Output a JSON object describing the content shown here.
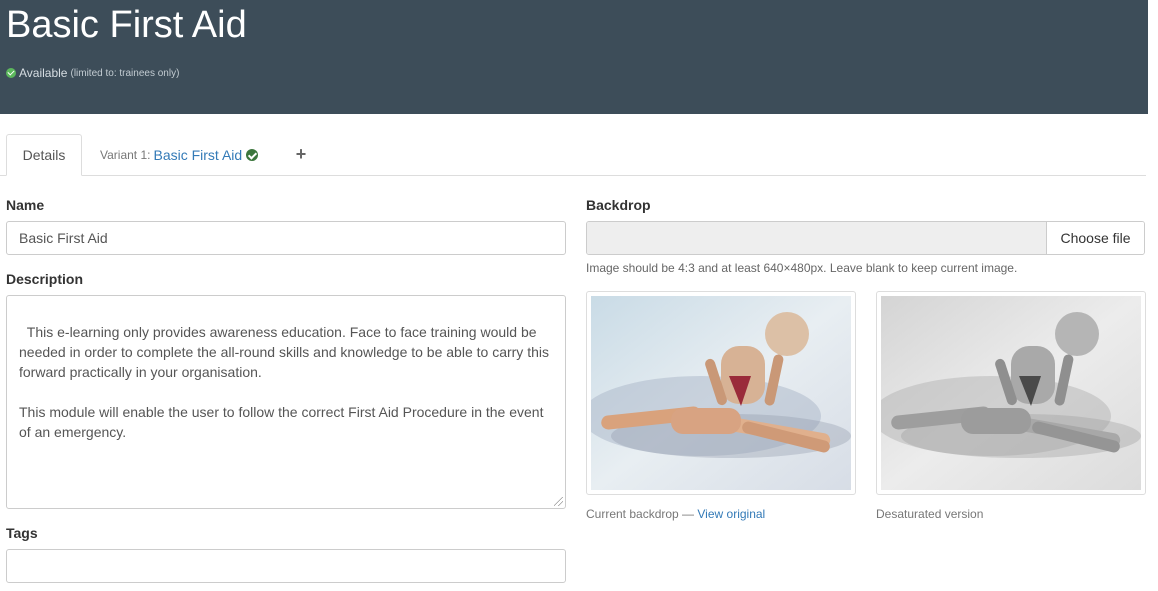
{
  "header": {
    "title": "Basic First Aid",
    "status": "Available",
    "status_limit": "(limited to: trainees only)"
  },
  "tabs": {
    "details": "Details",
    "variant_prefix": "Variant 1:",
    "variant_name": "Basic First Aid",
    "add": "+"
  },
  "form": {
    "name_label": "Name",
    "name_value": "Basic First Aid",
    "description_label": "Description",
    "description_value": "This e-learning only provides awareness education. Face to face training would be needed in order to complete the all-round skills and knowledge to be able to carry this forward practically in your organisation.\n\nThis module will enable the user to follow the correct First Aid Procedure in the event of an emergency.",
    "tags_label": "Tags",
    "tags_value": ""
  },
  "backdrop": {
    "label": "Backdrop",
    "choose_file": "Choose file",
    "help": "Image should be 4:3 and at least 640×480px. Leave blank to keep current image.",
    "current_caption": "Current backdrop —",
    "view_original": "View original",
    "desaturated_caption": "Desaturated version"
  },
  "colors": {
    "header_bg": "#3d4d59",
    "link": "#337ab7",
    "available_green": "#5cb85c"
  }
}
